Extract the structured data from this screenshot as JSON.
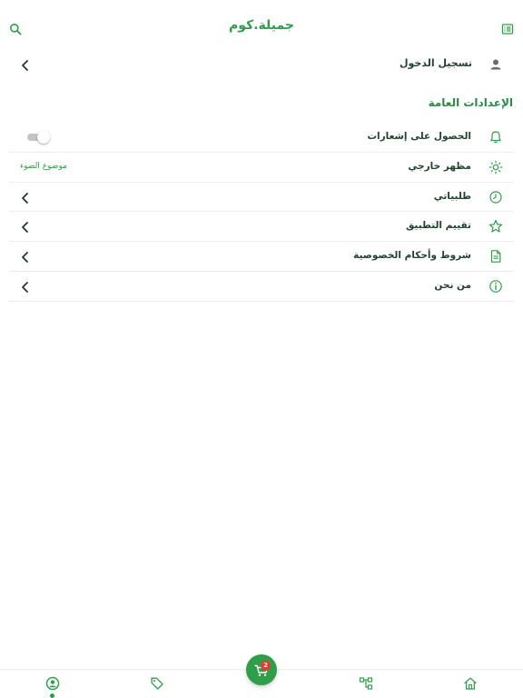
{
  "header": {
    "logo_text": "جميلة.كوم",
    "search_icon": "search-icon",
    "menu_icon": "list-icon"
  },
  "account": {
    "login_label": "تسجيل الدخول",
    "icon": "user-icon"
  },
  "general_settings": {
    "title": "الإعدادات العامة",
    "items": [
      {
        "label": "الحصول على إشعارات",
        "icon": "bell-icon",
        "control": "toggle",
        "enabled": false
      },
      {
        "label": "مظهر خارجي",
        "icon": "sun-icon",
        "value": "موضوع الضوء"
      },
      {
        "label": "طلبياتي",
        "icon": "clock-icon",
        "control": "chevron"
      },
      {
        "label": "تقييم التطبيق",
        "icon": "star-icon",
        "control": "chevron"
      },
      {
        "label": "شروط وأحكام الخصوصية",
        "icon": "document-icon",
        "control": "chevron"
      },
      {
        "label": "من نحن",
        "icon": "info-icon",
        "control": "chevron"
      }
    ]
  },
  "bottom_nav": {
    "items": [
      {
        "icon": "home-icon"
      },
      {
        "icon": "categories-icon"
      },
      {
        "icon": "cart-icon",
        "badge": "2"
      },
      {
        "icon": "tag-icon"
      },
      {
        "icon": "account-icon",
        "active": true
      }
    ]
  },
  "colors": {
    "primary": "#2e9e48",
    "badge": "#e53935",
    "text": "#23422f",
    "divider": "#ededed"
  }
}
